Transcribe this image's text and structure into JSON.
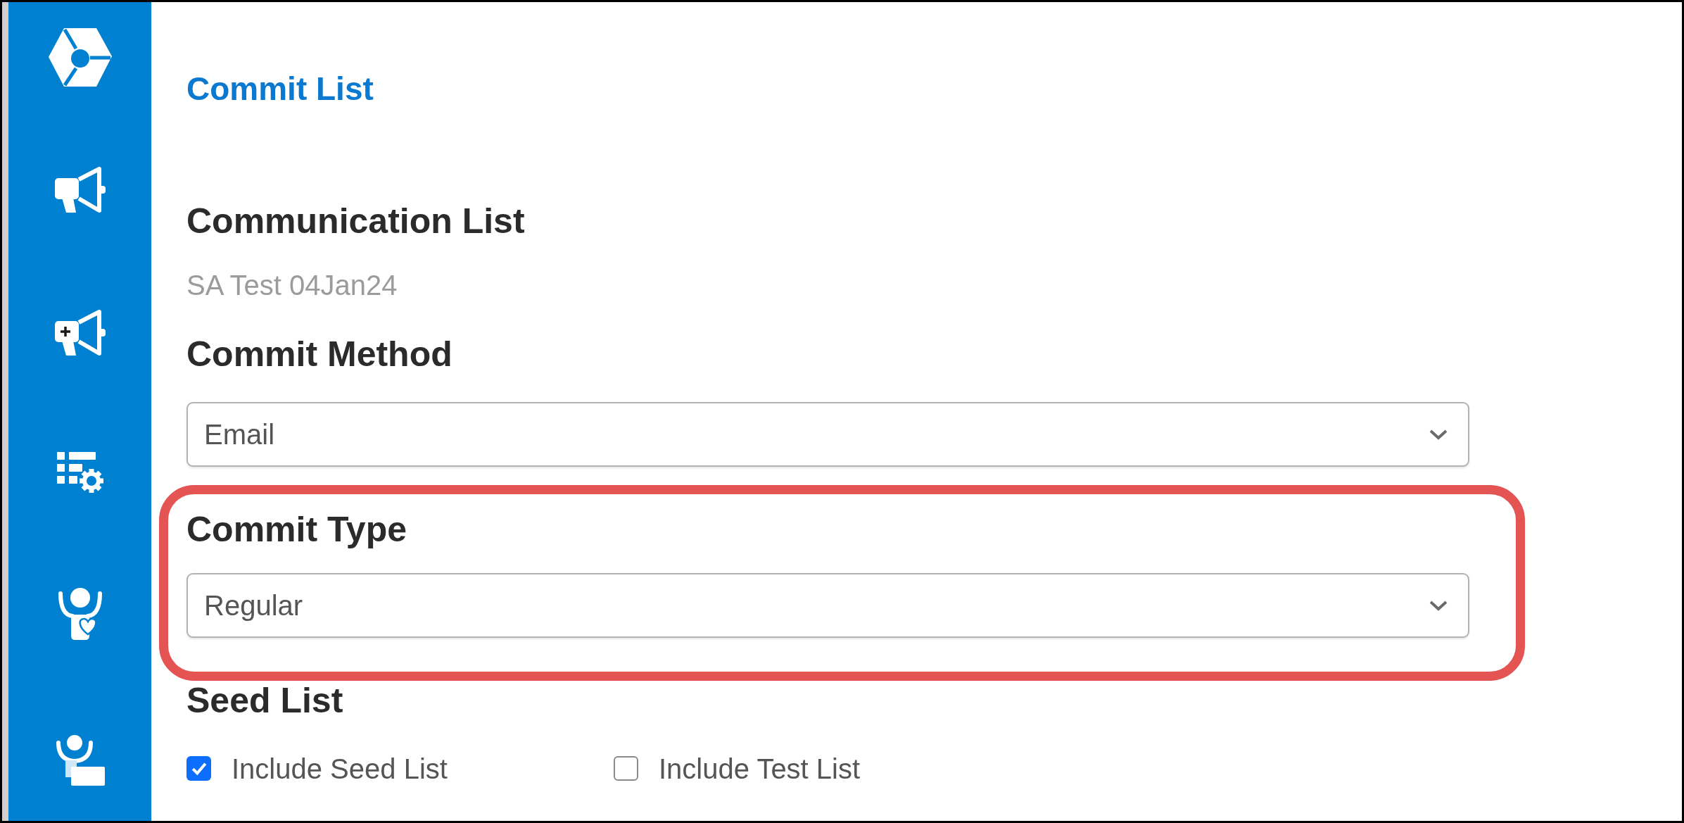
{
  "page_title": "Commit List",
  "communication_list": {
    "label": "Communication List",
    "value": "SA Test 04Jan24"
  },
  "fields": [
    {
      "label": "Commit Method",
      "value": "Email",
      "highlighted": false
    },
    {
      "label": "Commit Type",
      "value": "Regular",
      "highlighted": true
    }
  ],
  "seed_list": {
    "label": "Seed List",
    "options": [
      {
        "label": "Include Seed List",
        "checked": true
      },
      {
        "label": "Include Test List",
        "checked": false
      }
    ]
  }
}
